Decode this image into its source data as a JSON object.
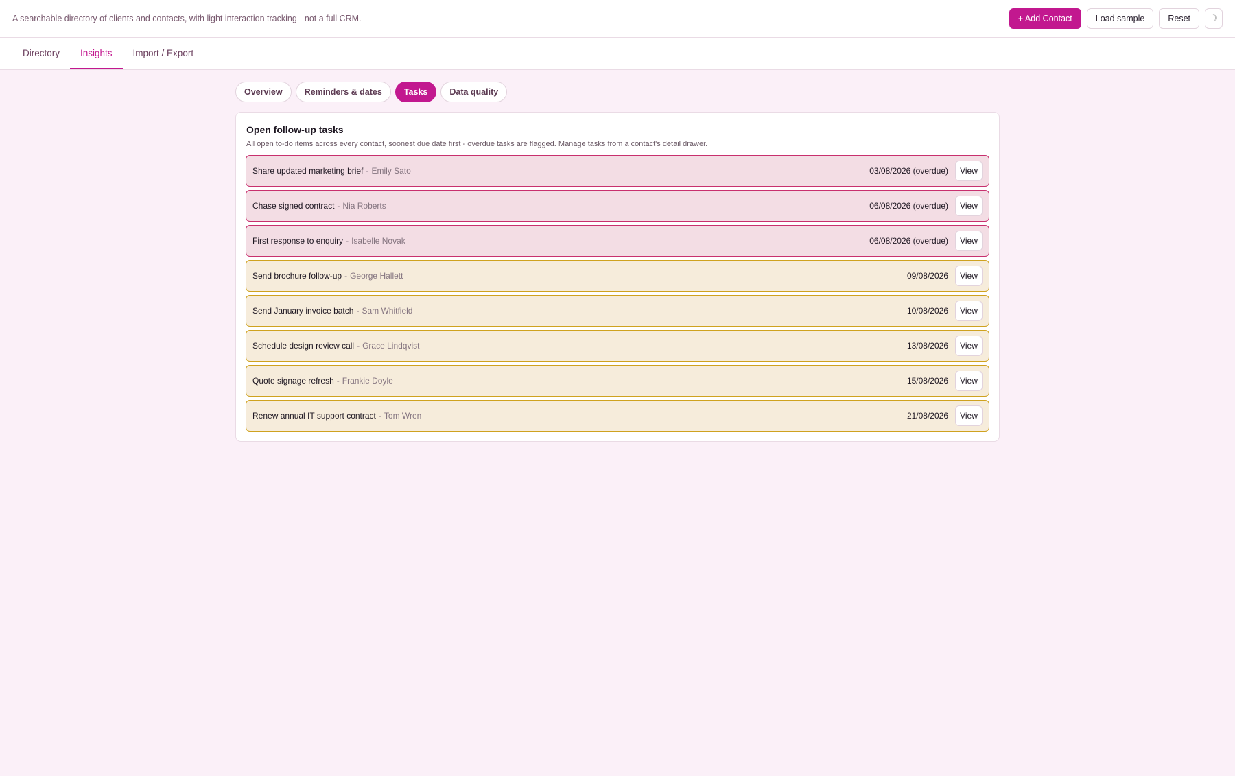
{
  "header": {
    "tagline": "A searchable directory of clients and contacts, with light interaction tracking - not a full CRM.",
    "add_contact_label": "+ Add Contact",
    "load_sample_label": "Load sample",
    "reset_label": "Reset",
    "theme_icon": "moon-icon",
    "theme_glyph": "☽"
  },
  "nav": {
    "tabs": [
      {
        "label": "Directory"
      },
      {
        "label": "Insights"
      },
      {
        "label": "Import / Export"
      }
    ],
    "active": "Insights"
  },
  "subtabs": {
    "items": [
      {
        "label": "Overview"
      },
      {
        "label": "Reminders & dates"
      },
      {
        "label": "Tasks"
      },
      {
        "label": "Data quality"
      }
    ],
    "active": "Tasks"
  },
  "tasks_card": {
    "title": "Open follow-up tasks",
    "description": "All open to-do items across every contact, soonest due date first - overdue tasks are flagged. Manage tasks from a contact's detail drawer.",
    "separator": "-",
    "view_label": "View",
    "tasks": [
      {
        "title": "Share updated marketing brief",
        "contact": "Emily Sato",
        "due": "03/08/2026 (overdue)",
        "status": "overdue"
      },
      {
        "title": "Chase signed contract",
        "contact": "Nia Roberts",
        "due": "06/08/2026 (overdue)",
        "status": "overdue"
      },
      {
        "title": "First response to enquiry",
        "contact": "Isabelle Novak",
        "due": "06/08/2026 (overdue)",
        "status": "overdue"
      },
      {
        "title": "Send brochure follow-up",
        "contact": "George Hallett",
        "due": "09/08/2026",
        "status": "upcoming"
      },
      {
        "title": "Send January invoice batch",
        "contact": "Sam Whitfield",
        "due": "10/08/2026",
        "status": "upcoming"
      },
      {
        "title": "Schedule design review call",
        "contact": "Grace Lindqvist",
        "due": "13/08/2026",
        "status": "upcoming"
      },
      {
        "title": "Quote signage refresh",
        "contact": "Frankie Doyle",
        "due": "15/08/2026",
        "status": "upcoming"
      },
      {
        "title": "Renew annual IT support contract",
        "contact": "Tom Wren",
        "due": "21/08/2026",
        "status": "upcoming"
      }
    ]
  },
  "colors": {
    "accent": "#c2188f",
    "overdue_border": "#c8306e",
    "overdue_bg": "#f3dde4",
    "upcoming_border": "#cfa21f",
    "upcoming_bg": "#f6ecdb",
    "page_bg": "#fbf0f8"
  }
}
